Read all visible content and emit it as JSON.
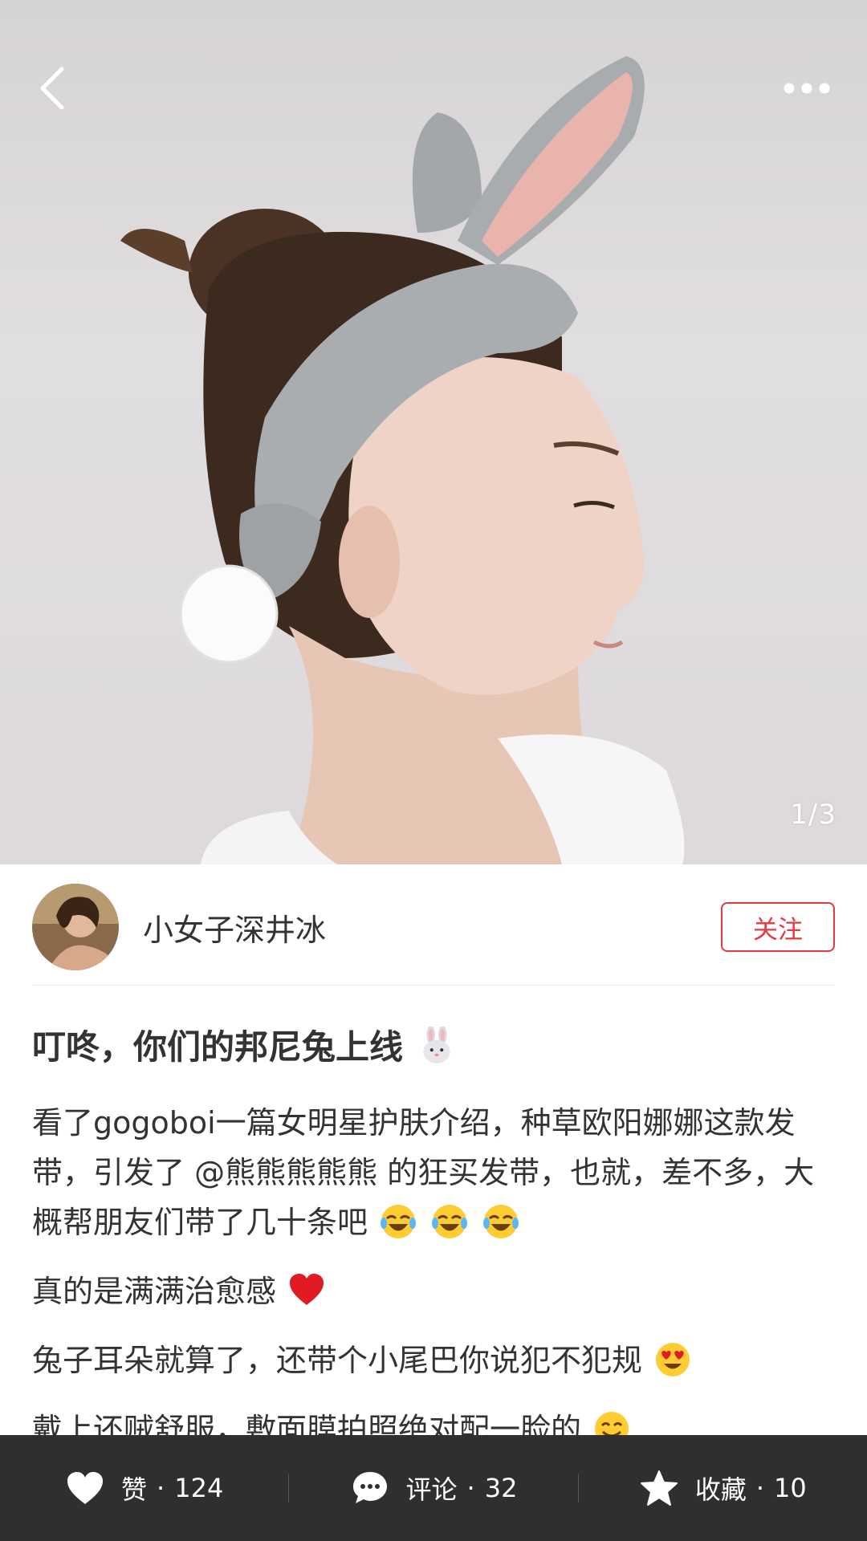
{
  "header": {
    "back_icon": "chevron-left-icon",
    "more_icon": "more-dots-icon",
    "page_indicator": "1/3"
  },
  "author": {
    "name": "小女子深井冰",
    "follow_label": "关注"
  },
  "post": {
    "title": "叮咚，你们的邦尼兔上线",
    "paragraphs": [
      {
        "text": "看了gogoboi一篇女明星护肤介绍，种草欧阳娜娜这款发带，引发了 @熊熊熊熊熊 的狂买发带，也就，差不多，大概帮朋友们带了几十条吧",
        "emoji": "laughing-tears-emoji"
      },
      {
        "text": "真的是满满治愈感",
        "emoji": "red-heart-emoji"
      },
      {
        "text": "兔子耳朵就算了，还带个小尾巴你说犯不犯规",
        "emoji": "heart-eyes-emoji"
      },
      {
        "text": "戴上还贼舒服，敷面膜拍照绝对配一脸的",
        "emoji": "smile-emoji"
      }
    ]
  },
  "actions": {
    "like": {
      "label": "赞",
      "separator": "·",
      "count": "124"
    },
    "comment": {
      "label": "评论",
      "separator": "·",
      "count": "32"
    },
    "collect": {
      "label": "收藏",
      "separator": "·",
      "count": "10"
    }
  },
  "colors": {
    "accent_red": "#e6393f",
    "bottom_bar": "#2f2f31",
    "text": "#333333"
  }
}
